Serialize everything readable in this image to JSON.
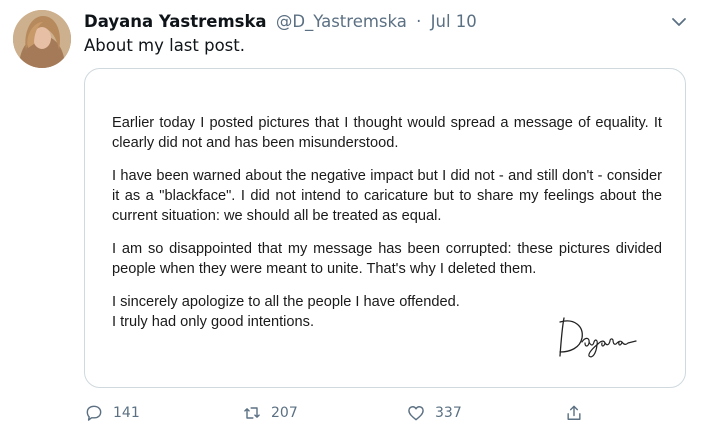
{
  "tweet": {
    "author_name": "Dayana Yastremska",
    "handle": "@D_Yastremska",
    "separator": "·",
    "date": "Jul 10",
    "text": "About my last post."
  },
  "statement": {
    "paragraphs": [
      "Earlier today I posted pictures that I thought would spread a message of equality. It clearly did not and has been misunderstood.",
      "I have been warned about the negative impact but I did not - and still don't - consider it as a \"blackface\". I did not intend to caricature but to share my feelings about the current situation: we should all be treated as equal.",
      "I am so disappointed that my message has been corrupted: these pictures divided people when they were meant to unite. That's why I deleted them."
    ],
    "closing_lines": [
      "I sincerely apologize to all the people I have offended.",
      "I truly had only good intentions."
    ],
    "signature": "Dayana"
  },
  "actions": {
    "reply_count": "141",
    "retweet_count": "207",
    "like_count": "337"
  },
  "icons": {
    "menu": "chevron-down-icon",
    "reply": "speech-bubble-icon",
    "retweet": "retweet-arrows-icon",
    "like": "heart-outline-icon",
    "share": "share-upload-icon"
  },
  "colors": {
    "text": "#0f1419",
    "secondary": "#5b7083",
    "border": "#cfd9de"
  }
}
